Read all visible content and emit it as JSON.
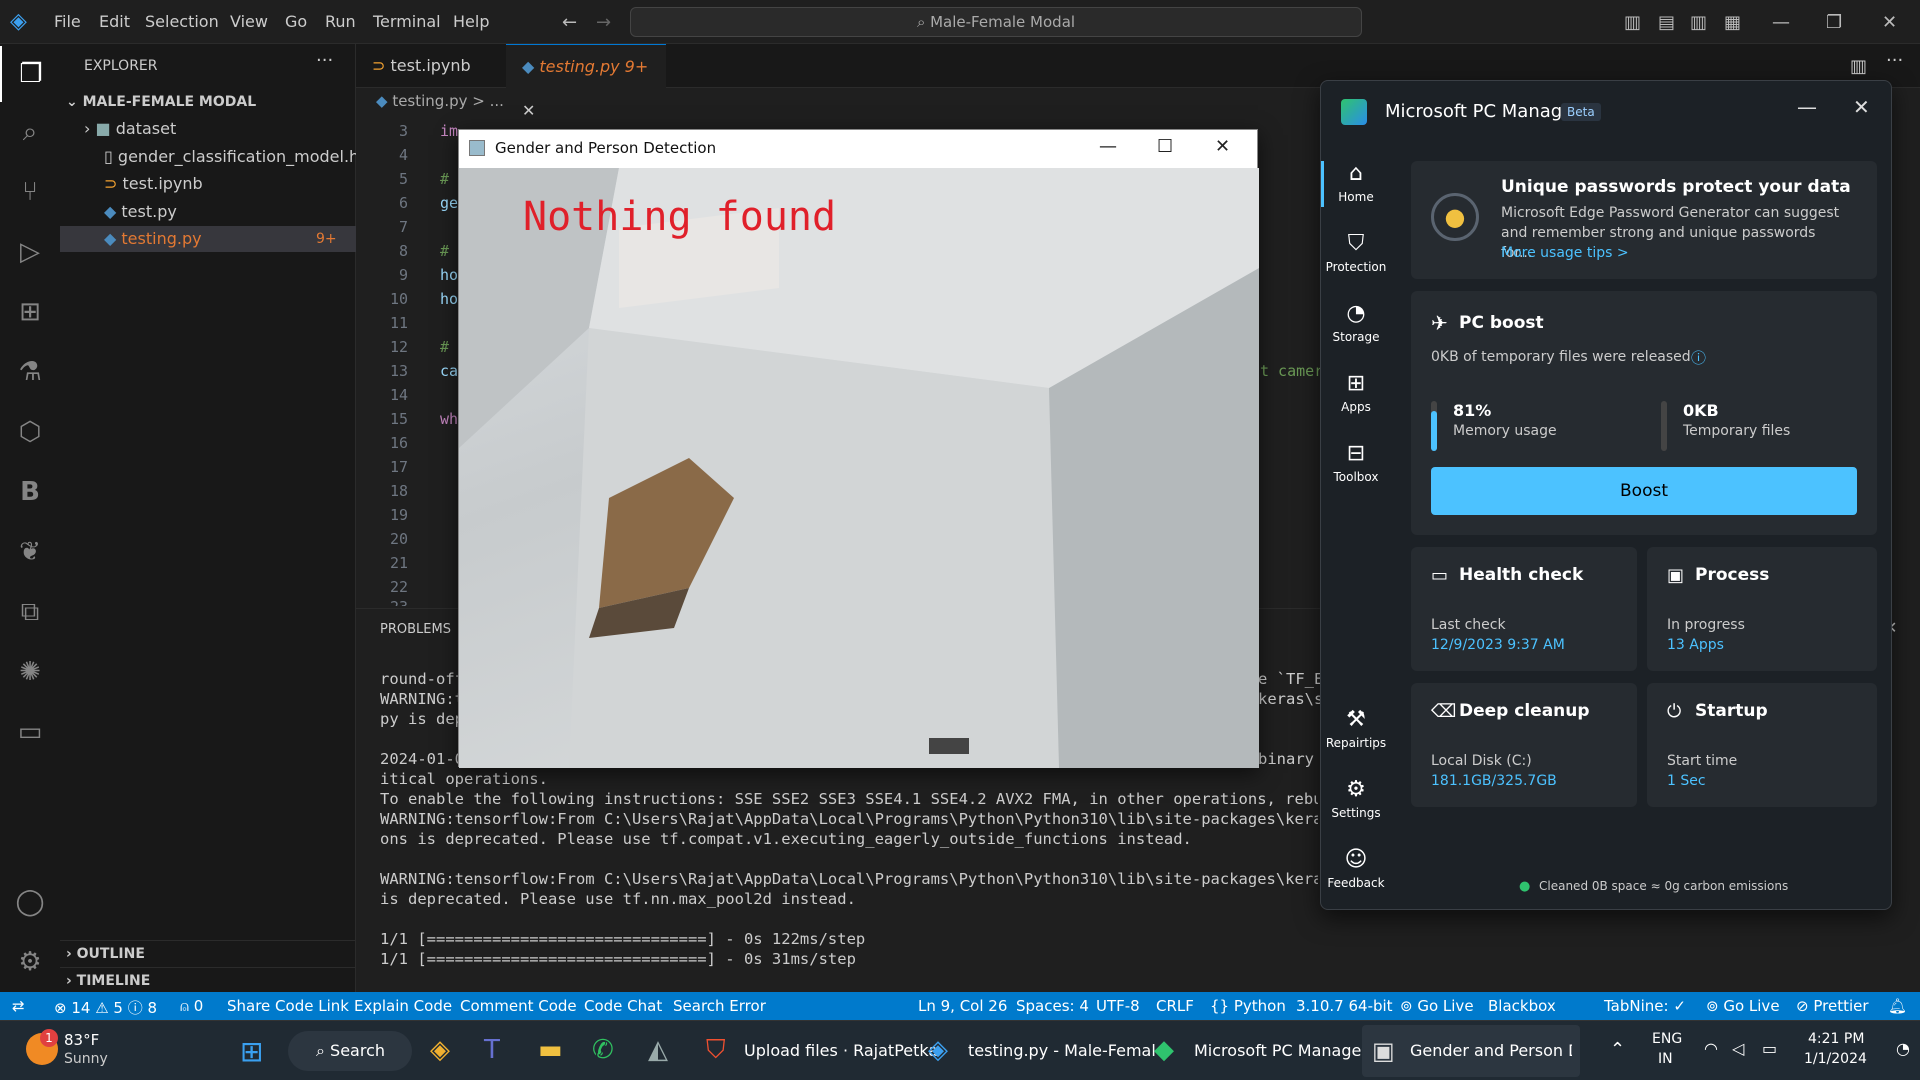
{
  "vscode": {
    "menu": [
      "File",
      "Edit",
      "Selection",
      "View",
      "Go",
      "Run",
      "Terminal",
      "Help"
    ],
    "search": "Male-Female Modal",
    "explorer_title": "EXPLORER",
    "folder": "MALE-FEMALE MODAL",
    "files": [
      {
        "name": "dataset"
      },
      {
        "name": "gender_classification_model.h5"
      },
      {
        "name": "test.ipynb"
      },
      {
        "name": "test.py"
      },
      {
        "name": "testing.py",
        "badge": "9+"
      }
    ],
    "outline": "OUTLINE",
    "timeline": "TIMELINE",
    "tabs": [
      {
        "label": "test.ipynb"
      },
      {
        "label": "testing.py",
        "badge": "9+"
      }
    ],
    "breadcrumb": "testing.py > ...",
    "line_numbers": [
      "3",
      "4",
      "5",
      "6",
      "7",
      "8",
      "9",
      "10",
      "11",
      "12",
      "13",
      "14",
      "15",
      "16",
      "17",
      "18",
      "19",
      "20",
      "21",
      "22",
      "23"
    ],
    "code_fragments": [
      "im",
      "#",
      "ge",
      "#",
      "ho",
      "ho",
      "#",
      "ca",
      "wh"
    ],
    "code_right": "t camer",
    "problems": "PROBLEMS",
    "terminal": [
      "round-off",
      "WARNING:t",
      "py is dep",
      "",
      "2024-01-0",
      "itical operations.",
      "To enable the following instructions: SSE SSE2 SSE3 SSE4.1 SSE4.2 AVX2 FMA, in other operations, rebuild",
      "WARNING:tensorflow:From C:\\Users\\Rajat\\AppData\\Local\\Programs\\Python\\Python310\\lib\\site-packages\\keras\\sr",
      "ons is deprecated. Please use tf.compat.v1.executing_eagerly_outside_functions instead.",
      "",
      "WARNING:tensorflow:From C:\\Users\\Rajat\\AppData\\Local\\Programs\\Python\\Python310\\lib\\site-packages\\keras\\sr",
      "is deprecated. Please use tf.nn.max_pool2d instead.",
      "",
      "1/1 [==============================] - 0s 122ms/step",
      "1/1 [==============================] - 0s 31ms/step"
    ],
    "terminal_right": [
      "e `TF_EN",
      "keras\\sr",
      "binary i"
    ]
  },
  "cv_window": {
    "title": "Gender and Person Detection",
    "overlay": "Nothing found"
  },
  "pc_manager": {
    "title": "Microsoft PC Manager",
    "beta": "Beta",
    "nav": [
      "Home",
      "Protection",
      "Storage",
      "Apps",
      "Toolbox",
      "Repairtips",
      "Settings",
      "Feedback"
    ],
    "tip": {
      "heading": "Unique passwords protect your data",
      "body": "Microsoft Edge Password Generator can suggest and remember strong and unique passwords for...",
      "link": "More usage tips >"
    },
    "boost": {
      "heading": "PC boost",
      "status": "0KB of temporary files were released",
      "memory_value": "81%",
      "memory_label": "Memory usage",
      "memory_fraction": 0.81,
      "temp_value": "0KB",
      "temp_label": "Temporary files",
      "button": "Boost"
    },
    "health": {
      "heading": "Health check",
      "label": "Last check",
      "value": "12/9/2023 9:37 AM"
    },
    "process": {
      "heading": "Process",
      "label": "In progress",
      "value": "13 Apps"
    },
    "cleanup": {
      "heading": "Deep cleanup",
      "label": "Local Disk (C:)",
      "value": "181.1GB/325.7GB"
    },
    "startup": {
      "heading": "Startup",
      "label": "Start time",
      "value": "1 Sec"
    },
    "footer": "Cleaned 0B space ≈ 0g carbon emissions"
  },
  "statusbar": {
    "errors": "14",
    "warnings": "5",
    "info": "8",
    "ports": "0",
    "left": [
      "Share Code Link",
      "Explain Code",
      "Comment Code",
      "Code Chat",
      "Search Error"
    ],
    "right": [
      "Ln 9, Col 26",
      "Spaces: 4",
      "UTF-8",
      "CRLF",
      "Python",
      "3.10.7 64-bit",
      "Go Live",
      "Blackbox",
      "TabNine: ✓",
      "Go Live",
      "Prettier"
    ]
  },
  "taskbar": {
    "temp": "83°F",
    "weather": "Sunny",
    "search": "Search",
    "apps": [
      "Upload files · RajatPetka",
      "testing.py - Male-Femal",
      "Microsoft PC Manager",
      "Gender and Person Dete"
    ],
    "lang1": "ENG",
    "lang2": "IN",
    "time": "4:21 PM",
    "date": "1/1/2024",
    "notif": "1"
  },
  "colors": {
    "accent": "#007acc",
    "boost": "#4cc2ff",
    "link": "#4cc2ff",
    "overlay": "#e0202a"
  }
}
